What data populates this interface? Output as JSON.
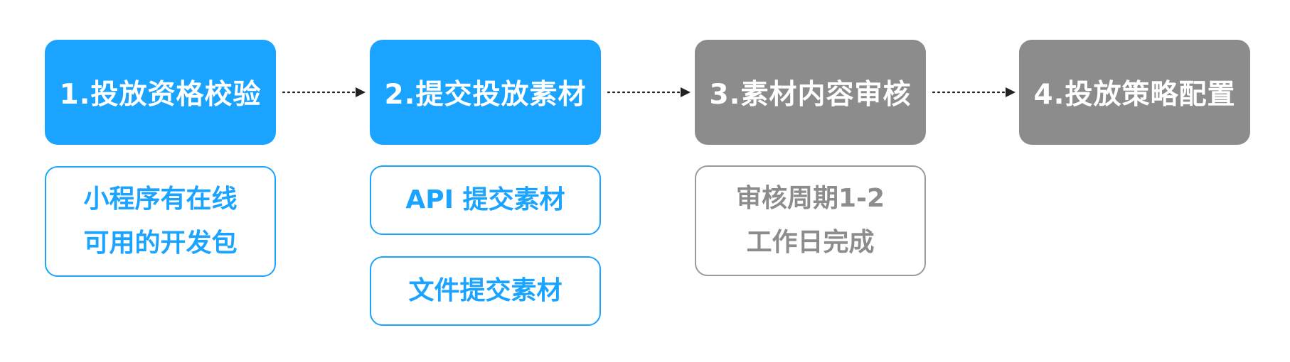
{
  "steps": [
    {
      "label": "1.投放资格校验",
      "color": "#1aa3ff",
      "state": "active"
    },
    {
      "label": "2.提交投放素材",
      "color": "#1aa3ff",
      "state": "active"
    },
    {
      "label": "3.素材内容审核",
      "color": "#8c8c8c",
      "state": "inactive"
    },
    {
      "label": "4.投放策略配置",
      "color": "#8c8c8c",
      "state": "inactive"
    }
  ],
  "notes": {
    "step1": {
      "line1": "小程序有在线",
      "line2": "可用的开发包"
    },
    "step2_api": "API 提交素材",
    "step2_file": "文件提交素材",
    "step3": {
      "line1": "审核周期1-2",
      "line2": "工作日完成"
    }
  }
}
